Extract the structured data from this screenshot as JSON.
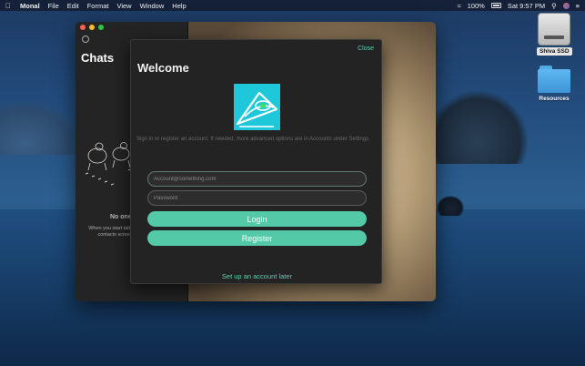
{
  "menubar": {
    "app_name": "Monal",
    "items": [
      "File",
      "Edit",
      "Format",
      "View",
      "Window",
      "Help"
    ],
    "battery": "100%",
    "clock": "Sat 9:57 PM"
  },
  "desktop": {
    "disk_label": "Shiva SSD",
    "folder_label": "Resources"
  },
  "sidebar": {
    "title": "Chats",
    "empty_title": "No one",
    "empty_desc": "When you start talking the contacts screen h"
  },
  "welcome": {
    "title": "Welcome",
    "close_label": "Close",
    "info_text": "Sign in or register an account.  If needed, more advanced options are in Accounts under Settings.",
    "account_placeholder": "Account@something.com",
    "password_placeholder": "Password",
    "login_label": "Login",
    "register_label": "Register",
    "later_label": "Set up an account later"
  },
  "colors": {
    "accent": "#54c9a8",
    "link": "#5ccfb0",
    "logo_bg": "#1ec8d8"
  }
}
